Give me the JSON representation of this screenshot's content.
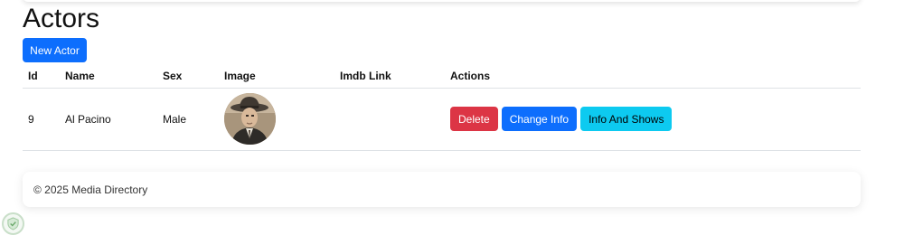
{
  "page": {
    "title": "Actors",
    "new_button_label": "New Actor"
  },
  "table": {
    "headers": [
      "Id",
      "Name",
      "Sex",
      "Image",
      "Imdb Link",
      "Actions"
    ],
    "rows": [
      {
        "id": "9",
        "name": "Al Pacino",
        "sex": "Male",
        "image_icon": "actor-portrait",
        "imdb_link": "",
        "actions": {
          "delete": "Delete",
          "change": "Change Info",
          "info": "Info And Shows"
        }
      }
    ]
  },
  "footer": {
    "text": "© 2025 Media Directory"
  },
  "colors": {
    "primary": "#0d6efd",
    "danger": "#dc3545",
    "info": "#0dcaf0"
  },
  "icons": {
    "corner_badge": "shield-check-icon"
  }
}
